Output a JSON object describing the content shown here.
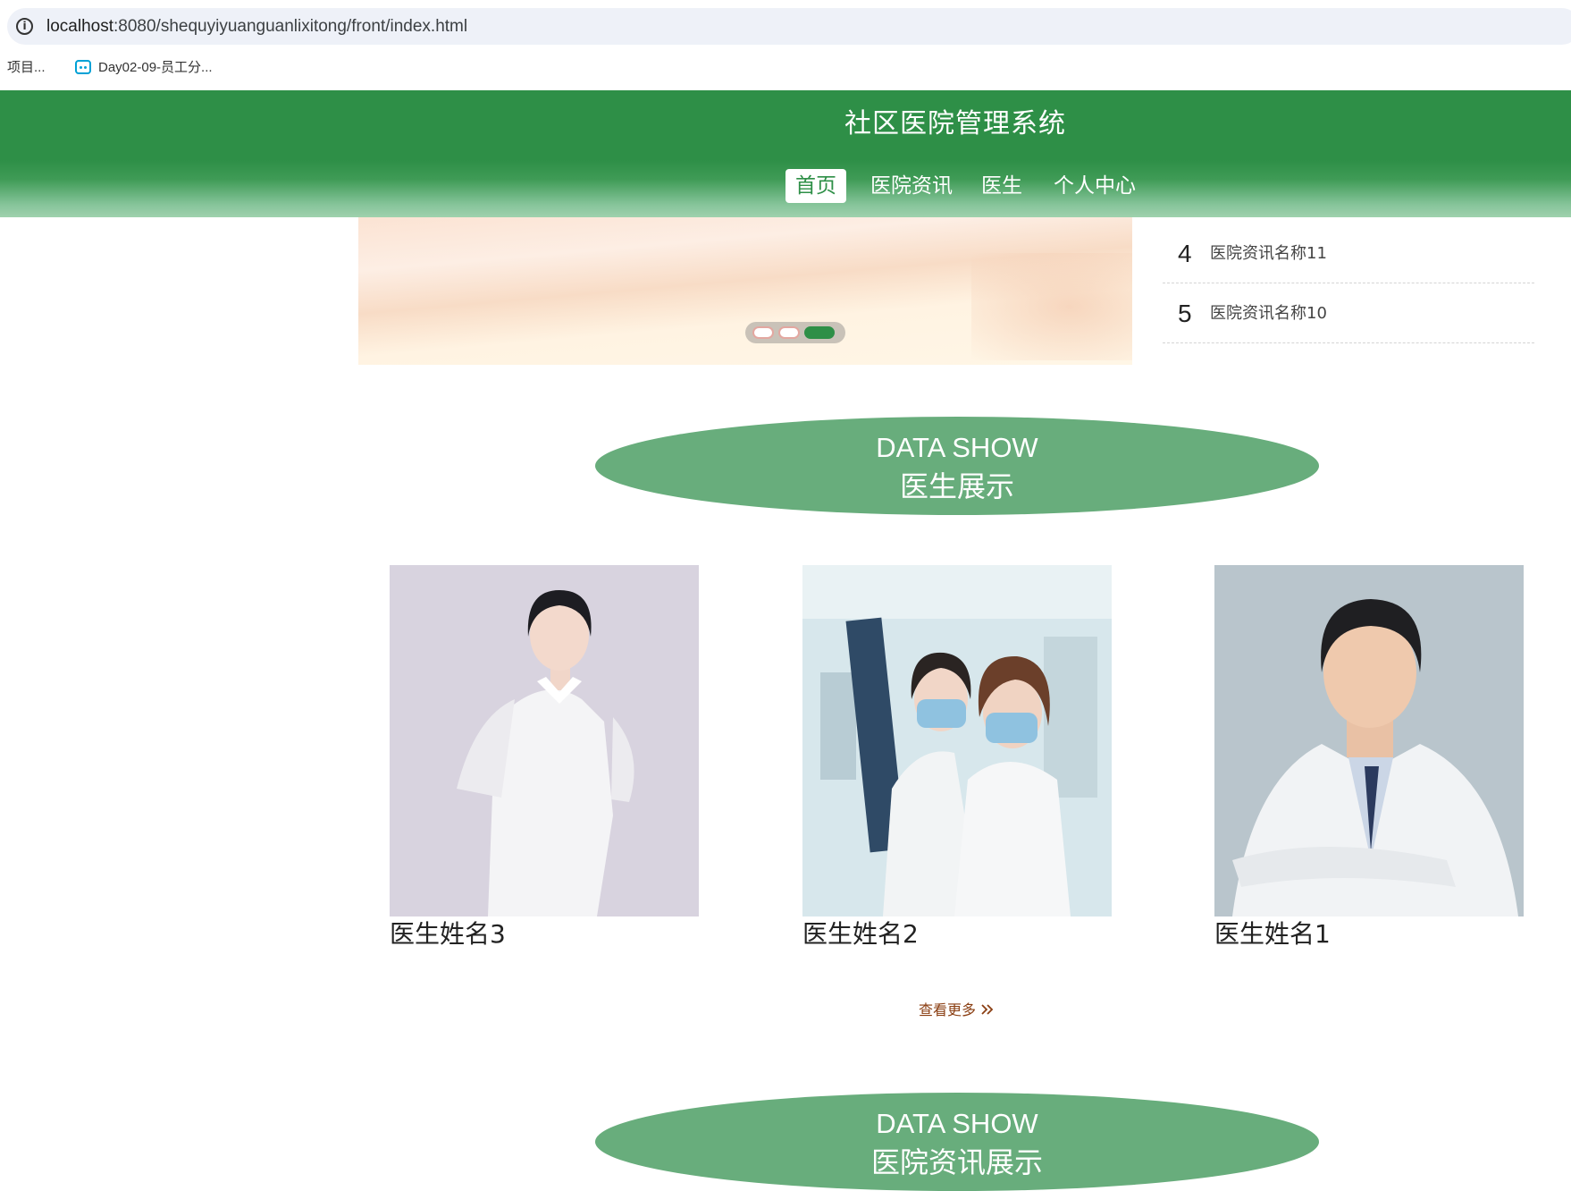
{
  "browser": {
    "url_host": "localhost",
    "url_rest": ":8080/shequyiyuanguanlixitong/front/index.html",
    "bookmarks": [
      {
        "label": "项目..."
      },
      {
        "label": "Day02-09-员工分..."
      }
    ]
  },
  "header": {
    "title": "社区医院管理系统",
    "nav": [
      {
        "label": "首页",
        "active": true
      },
      {
        "label": "医院资讯",
        "active": false
      },
      {
        "label": "医生",
        "active": false
      },
      {
        "label": "个人中心",
        "active": false
      }
    ],
    "colors": {
      "brand": "#2e8f47",
      "pill": "#68ad7c",
      "more_link": "#8a3e12"
    }
  },
  "banner": {
    "slides_count": 3,
    "active_slide": 3
  },
  "news": [
    {
      "num": "4",
      "name": "医院资讯名称11"
    },
    {
      "num": "5",
      "name": "医院资讯名称10"
    }
  ],
  "sections": {
    "doctors": {
      "en": "DATA SHOW",
      "cn": "医生展示"
    },
    "news": {
      "en": "DATA SHOW",
      "cn": "医院资讯展示"
    }
  },
  "doctors": [
    {
      "name": "医生姓名3"
    },
    {
      "name": "医生姓名2"
    },
    {
      "name": "医生姓名1"
    }
  ],
  "more_label": "查看更多"
}
